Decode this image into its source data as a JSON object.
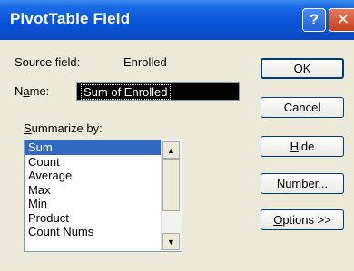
{
  "window": {
    "title": "PivotTable Field",
    "help_glyph": "?",
    "close_glyph": "✕"
  },
  "source_field": {
    "label": "Source field:",
    "value": "Enrolled"
  },
  "name_field": {
    "label_pre": "N",
    "label_u": "a",
    "label_post": "me:",
    "value": "Sum of Enrolled"
  },
  "summarize": {
    "label_u": "S",
    "label_rest": "ummarize by:"
  },
  "list": {
    "items": [
      "Sum",
      "Count",
      "Average",
      "Max",
      "Min",
      "Product",
      "Count Nums"
    ],
    "selected": "Sum",
    "up_glyph": "▲",
    "down_glyph": "▼"
  },
  "buttons": {
    "ok": "OK",
    "cancel": "Cancel",
    "hide_u": "H",
    "hide_rest": "ide",
    "number_u": "N",
    "number_rest": "umber...",
    "options_u": "O",
    "options_rest": "ptions >>"
  }
}
